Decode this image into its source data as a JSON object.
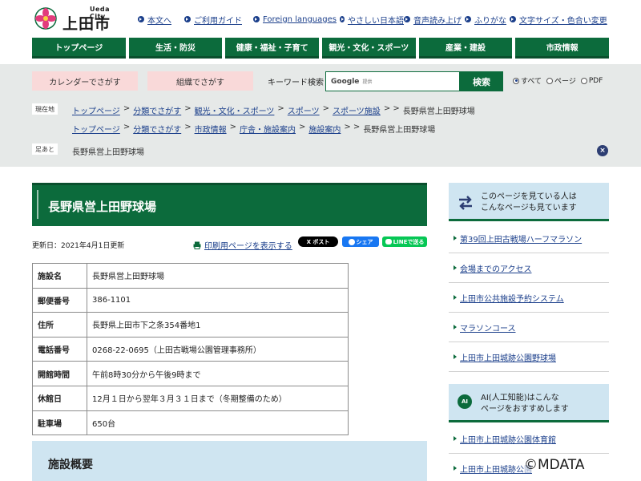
{
  "header": {
    "logo_sub": "Ueda City",
    "logo_main": "上田市",
    "utility_links": [
      "本文へ",
      "ご利用ガイド",
      "Foreign languages",
      "やさしい日本語",
      "音声読み上げ",
      "ふりがな",
      "文字サイズ・色合い変更"
    ]
  },
  "gnav": [
    "トップページ",
    "生活・防災",
    "健康・福祉・子育て",
    "観光・文化・スポーツ",
    "産業・建設",
    "市政情報"
  ],
  "search": {
    "calendar_label": "カレンダーでさがす",
    "org_label": "組織でさがす",
    "keyword_label": "キーワード検索",
    "input_brand": "Google",
    "input_brand_sub": "提供",
    "button_label": "検索",
    "options": [
      {
        "label": "すべて",
        "selected": true
      },
      {
        "label": "ページ",
        "selected": false
      },
      {
        "label": "PDF",
        "selected": false
      }
    ]
  },
  "breadcrumb": {
    "current_label": "現在地",
    "row1": [
      "トップページ",
      "分類でさがす",
      "観光・文化・スポーツ",
      "スポーツ",
      "スポーツ施設"
    ],
    "row2": [
      "トップページ",
      "分類でさがす",
      "市政情報",
      "庁舎・施設案内",
      "施設案内"
    ],
    "current_page": "長野県営上田野球場",
    "trail_label": "足あと",
    "trail_text": "長野県営上田野球場",
    "close_glyph": "×"
  },
  "main": {
    "title": "長野県営上田野球場",
    "updated": "更新日：2021年4月1日更新",
    "print_link": "印刷用ページを表示する",
    "sns": {
      "x": "X ポスト",
      "facebook": "シェア",
      "line": "LINEで送る"
    },
    "table": [
      {
        "label": "施設名",
        "value": "長野県営上田野球場"
      },
      {
        "label": "郵便番号",
        "value": "386-1101"
      },
      {
        "label": "住所",
        "value": "長野県上田市下之条354番地1"
      },
      {
        "label": "電話番号",
        "value": "0268-22-0695（上田古戦場公園管理事務所）"
      },
      {
        "label": "開館時間",
        "value": "午前8時30分から午後9時まで"
      },
      {
        "label": "休館日",
        "value": "12月１日から翌年３月３１日まで（冬期整備のため）"
      },
      {
        "label": "駐車場",
        "value": "650台"
      }
    ],
    "overview_heading": "施設概要"
  },
  "sidebar": {
    "viewed_heading": "このページを見ている人は\nこんなページも見ています",
    "viewed_line1": "このページを見ている人は",
    "viewed_line2": "こんなページも見ています",
    "viewed_items": [
      "第39回上田古戦場ハーフマラソン",
      "会場までのアクセス",
      "上田市公共施設予約システム",
      "マラソンコース",
      "上田市上田城跡公園野球場"
    ],
    "ai_badge": "AI",
    "ai_line1": "AI(人工知能)はこんな",
    "ai_line2": "ページをおすすめします",
    "ai_items": [
      "上田市上田城跡公園体育館",
      "上田市上田城跡公園"
    ]
  },
  "watermark": "©MDATA",
  "colors": {
    "brand_green": "#0c6b3c",
    "link_blue": "#1b3f8b",
    "pink_pill": "#f9d9d9",
    "light_blue": "#cfe5f1",
    "band_gray": "#e6e9e8"
  }
}
